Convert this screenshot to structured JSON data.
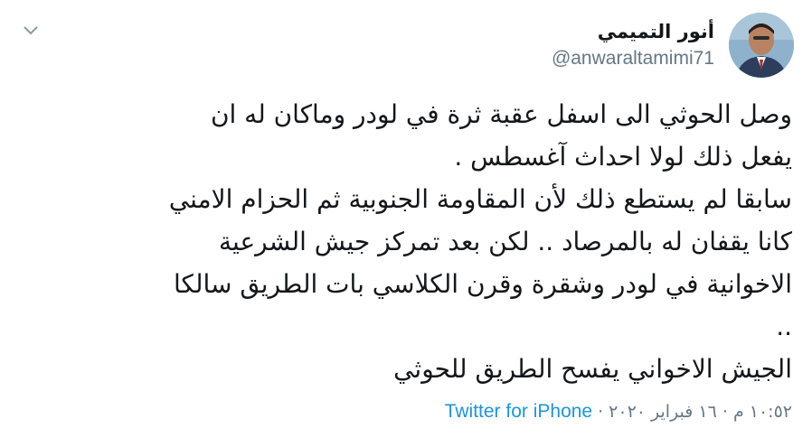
{
  "author": {
    "display_name": "أنور التميمي",
    "handle": "@anwaraltamimi71",
    "avatar_icon": "profile-photo"
  },
  "menu_icon": "chevron-down-icon",
  "tweet": {
    "lines": [
      "وصل الحوثي الى اسفل عقبة ثرة في لودر وماكان له ان",
      "يفعل ذلك لولا احداث آغسطس .",
      "سابقا لم يستطع ذلك لأن المقاومة الجنوبية ثم الحزام الامني",
      "كانا يقفان له بالمرصاد .. لكن بعد تمركز جيش الشرعية",
      "الاخوانية في لودر  وشقرة وقرن الكلاسي بات الطريق سالكا",
      "..",
      "الجيش الاخواني يفسح الطريق للحوثي"
    ]
  },
  "meta": {
    "source": "Twitter for iPhone",
    "separator": "·",
    "timestamp": "١٠:٥٢ م · ١٦ فبراير ٢٠٢٠"
  },
  "colors": {
    "link": "#1b95e0",
    "secondary_text": "#657786",
    "primary_text": "#14171a"
  }
}
